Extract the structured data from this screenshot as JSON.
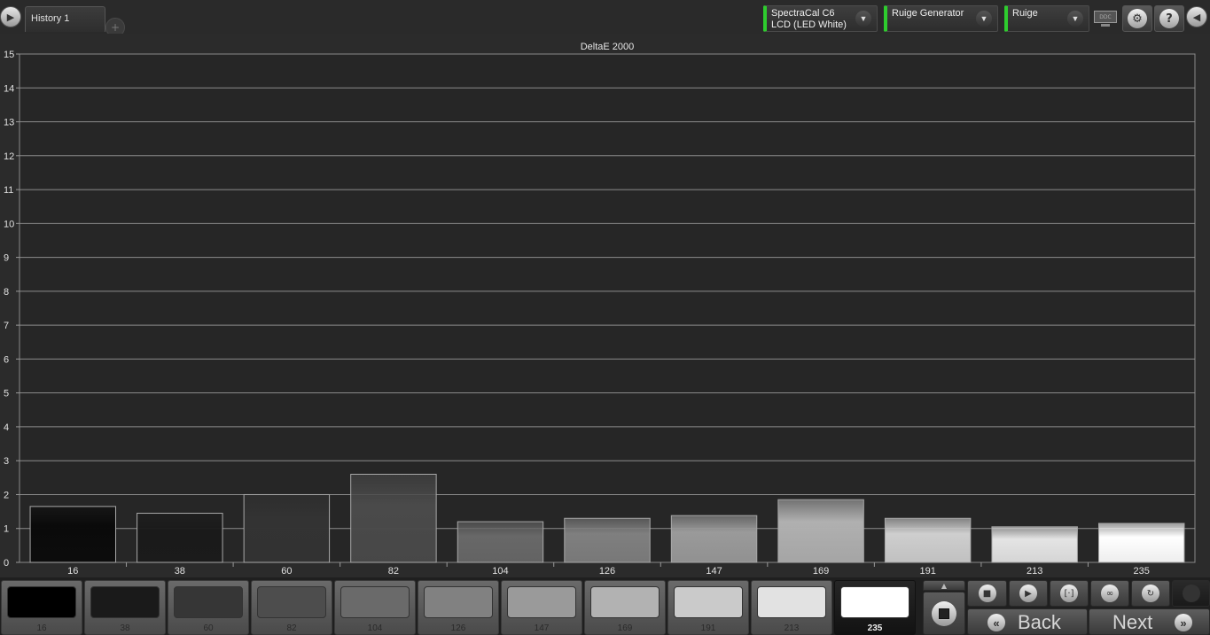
{
  "tabs": [
    {
      "label": "History 1"
    },
    {
      "label": "+"
    }
  ],
  "devices": [
    {
      "line1": "SpectraCal C6",
      "line2": "LCD (LED White)"
    },
    {
      "line1": "Ruige Generator",
      "line2": ""
    },
    {
      "line1": "Ruige",
      "line2": ""
    }
  ],
  "toolbar": {
    "ddc_label": "DDC",
    "settings_icon": "gear-icon",
    "help_label": "?",
    "accent_color": "#2ecc2e"
  },
  "chart_data": {
    "type": "bar",
    "title": "DeltaE 2000",
    "categories": [
      "16",
      "38",
      "60",
      "82",
      "104",
      "126",
      "147",
      "169",
      "191",
      "213",
      "235"
    ],
    "values": [
      1.65,
      1.45,
      2.0,
      2.6,
      1.2,
      1.3,
      1.38,
      1.85,
      1.3,
      1.05,
      1.15
    ],
    "bar_colors": [
      "#0a0a0a",
      "#1a1a1a",
      "#333333",
      "#4a4a4a",
      "#686868",
      "#7f7f7f",
      "#9a9a9a",
      "#b0b0b0",
      "#cecece",
      "#e4e4e4",
      "#ffffff"
    ],
    "ylim": [
      0,
      15
    ],
    "yticks": [
      "0",
      "1",
      "2",
      "3",
      "4",
      "5",
      "6",
      "7",
      "8",
      "9",
      "10",
      "11",
      "12",
      "13",
      "14",
      "15"
    ],
    "grid": true
  },
  "swatches": [
    {
      "label": "16",
      "color": "#000000"
    },
    {
      "label": "38",
      "color": "#1a1a1a"
    },
    {
      "label": "60",
      "color": "#363636"
    },
    {
      "label": "82",
      "color": "#4d4d4d"
    },
    {
      "label": "104",
      "color": "#6a6a6a"
    },
    {
      "label": "126",
      "color": "#818181"
    },
    {
      "label": "147",
      "color": "#9a9a9a"
    },
    {
      "label": "169",
      "color": "#b2b2b2"
    },
    {
      "label": "191",
      "color": "#cacaca"
    },
    {
      "label": "213",
      "color": "#e2e2e2"
    },
    {
      "label": "235",
      "color": "#ffffff",
      "active": true
    }
  ],
  "controls": {
    "back_label": "Back",
    "next_label": "Next"
  }
}
